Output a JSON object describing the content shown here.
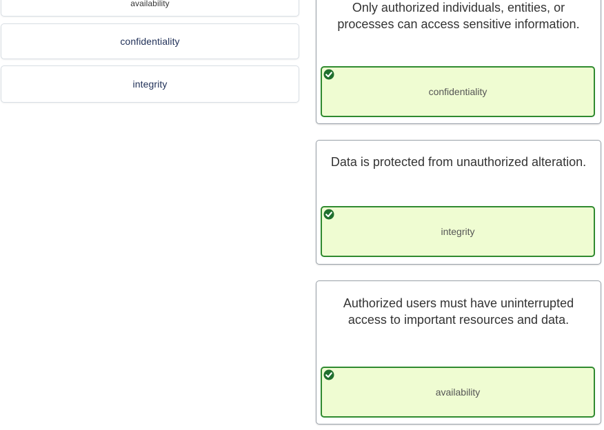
{
  "options": [
    {
      "label": "availability"
    },
    {
      "label": "confidentiality"
    },
    {
      "label": "integrity"
    }
  ],
  "questions": [
    {
      "text": "Only authorized individuals, entities, or processes can access sensitive information.",
      "answer": "confidentiality",
      "status_icon": "check-circle-icon"
    },
    {
      "text": "Data is protected from unauthorized alteration.",
      "answer": "integrity",
      "status_icon": "check-circle-icon"
    },
    {
      "text": "Authorized users must have uninterrupted access to important resources and data.",
      "answer": "availability",
      "status_icon": "check-circle-icon"
    }
  ],
  "colors": {
    "correct_border": "#2f8a2f",
    "correct_fill": "#effcd2",
    "check_bg": "#1f6f2e"
  }
}
